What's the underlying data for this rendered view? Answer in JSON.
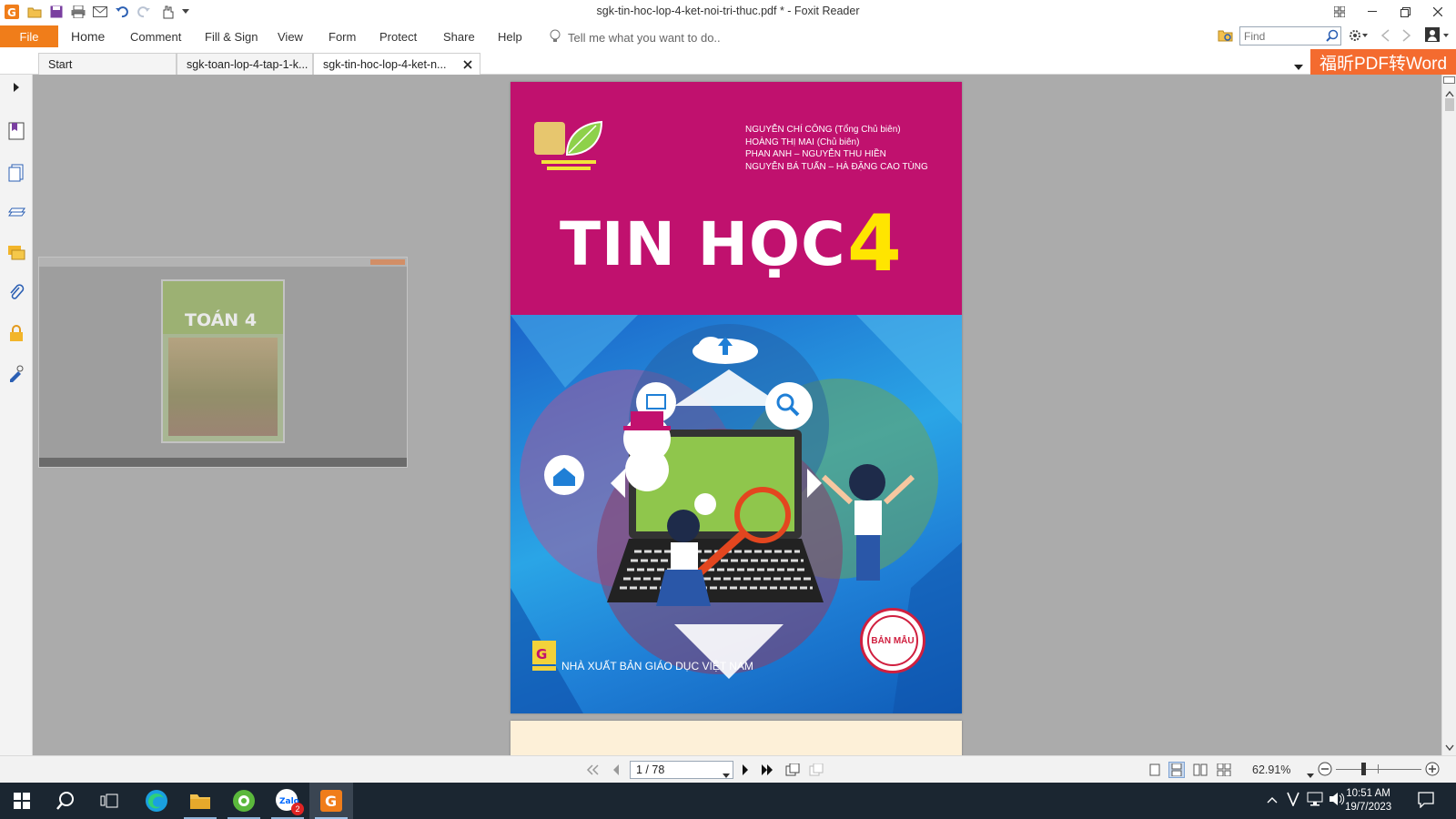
{
  "window": {
    "title": "sgk-tin-hoc-lop-4-ket-noi-tri-thuc.pdf * - Foxit Reader"
  },
  "menu": {
    "file": "File",
    "items": [
      "Home",
      "Comment",
      "Fill & Sign",
      "View",
      "Form",
      "Protect",
      "Share",
      "Help"
    ],
    "tell_me": "Tell me what you want to do..",
    "find_placeholder": "Find"
  },
  "tabs": [
    {
      "label": "Start"
    },
    {
      "label": "sgk-toan-lop-4-tap-1-k..."
    },
    {
      "label": "sgk-tin-hoc-lop-4-ket-n...",
      "closable": true
    }
  ],
  "promo": "福昕PDF转Word",
  "document": {
    "authors": [
      "NGUYỄN CHÍ CÔNG (Tổng Chủ biên)",
      "HOÀNG THỊ MAI (Chủ biên)",
      "PHAN ANH – NGUYỄN THU HIỀN",
      "NGUYỄN BÁ TUẤN – HÀ ĐẶNG CAO TÙNG"
    ],
    "title": "TIN HỌC",
    "number": "4",
    "publisher": "NHÀ XUẤT BẢN GIÁO DỤC VIỆT NAM",
    "stamp": "BẢN MẪU",
    "ghost_title": "TOÁN 4"
  },
  "status": {
    "page_indicator": "1 / 78",
    "zoom": "62.91%"
  },
  "taskbar": {
    "time": "10:51 AM",
    "date": "19/7/2023",
    "zalo_badge": "2"
  },
  "colors": {
    "accent": "#f07d1a",
    "cover_magenta": "#c0116e",
    "taskbar": "#1b2631"
  }
}
